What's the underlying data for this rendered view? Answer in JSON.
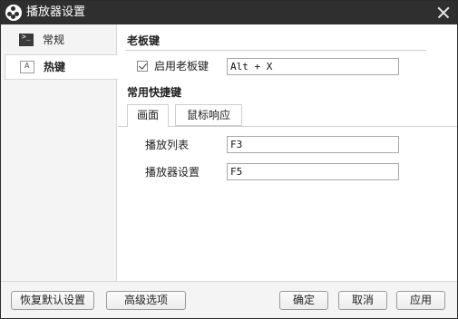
{
  "window": {
    "title": "播放器设置"
  },
  "sidebar": {
    "items": [
      {
        "label": "常规",
        "icon": "terminal-icon"
      },
      {
        "label": "热键",
        "icon": "keyboard-icon",
        "selected": true
      }
    ]
  },
  "boss_key": {
    "section_title": "老板键",
    "enable_label": "启用老板键",
    "enabled": true,
    "value": "Alt + X"
  },
  "shortcuts": {
    "section_title": "常用快捷键",
    "tabs": [
      {
        "label": "画面",
        "active": true
      },
      {
        "label": "鼠标响应",
        "active": false
      }
    ],
    "rows": [
      {
        "label": "播放列表",
        "value": "F3"
      },
      {
        "label": "播放器设置",
        "value": "F5"
      }
    ]
  },
  "footer": {
    "restore_label": "恢复默认设置",
    "advanced_label": "高级选项",
    "ok_label": "确定",
    "cancel_label": "取消",
    "apply_label": "应用"
  }
}
